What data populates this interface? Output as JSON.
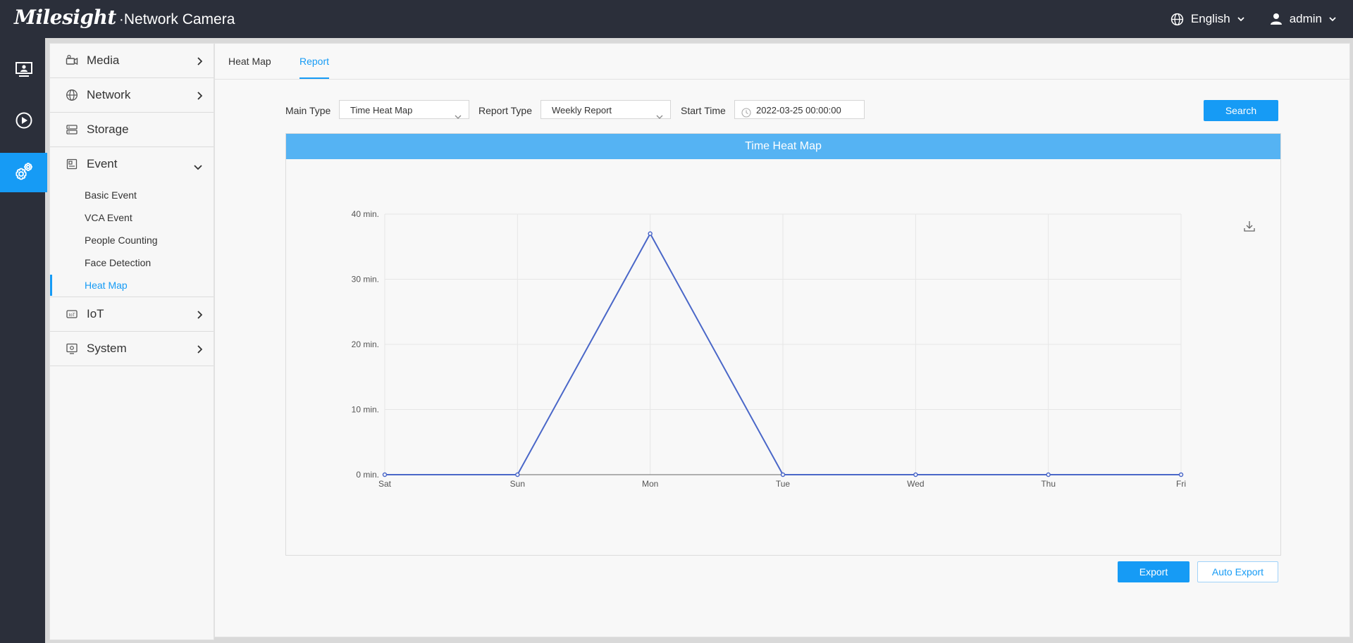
{
  "header": {
    "brand": "Milesight",
    "product": "·Network Camera",
    "language": "English",
    "user": "admin"
  },
  "rail": {
    "items": [
      {
        "icon": "live-view-icon"
      },
      {
        "icon": "playback-icon"
      },
      {
        "icon": "settings-icon",
        "active": true
      }
    ]
  },
  "sidebar": {
    "sections": [
      {
        "label": "Media",
        "icon": "camera-icon"
      },
      {
        "label": "Network",
        "icon": "globe-icon"
      },
      {
        "label": "Storage",
        "icon": "storage-icon"
      },
      {
        "label": "Event",
        "icon": "event-icon",
        "expanded": true,
        "items": [
          "Basic Event",
          "VCA Event",
          "People Counting",
          "Face Detection",
          "Heat Map"
        ],
        "active_item": "Heat Map"
      },
      {
        "label": "IoT",
        "icon": "iot-icon"
      },
      {
        "label": "System",
        "icon": "system-icon"
      }
    ]
  },
  "tabs": [
    {
      "label": "Heat Map",
      "active": false
    },
    {
      "label": "Report",
      "active": true
    }
  ],
  "filters": {
    "main_type_label": "Main Type",
    "main_type_value": "Time Heat Map",
    "report_type_label": "Report Type",
    "report_type_value": "Weekly Report",
    "start_time_label": "Start Time",
    "start_time_value": "2022-03-25 00:00:00",
    "search_label": "Search"
  },
  "chart_title": "Time Heat Map",
  "chart_data": {
    "type": "line",
    "title": "Time Heat Map",
    "categories": [
      "Sat",
      "Sun",
      "Mon",
      "Tue",
      "Wed",
      "Thu",
      "Fri"
    ],
    "series": [
      {
        "values": [
          0,
          0,
          37,
          0,
          0,
          0,
          0
        ]
      }
    ],
    "y_ticks": [
      "0 min.",
      "10 min.",
      "20 min.",
      "30 min.",
      "40 min."
    ],
    "ylim": [
      0,
      40
    ],
    "grid": true,
    "line_color": "#4a67c8"
  },
  "actions": {
    "export_label": "Export",
    "auto_export_label": "Auto Export"
  },
  "colors": {
    "accent": "#169bf5",
    "header_bg": "#2b2f3a",
    "chart_header": "#55b3f3"
  }
}
